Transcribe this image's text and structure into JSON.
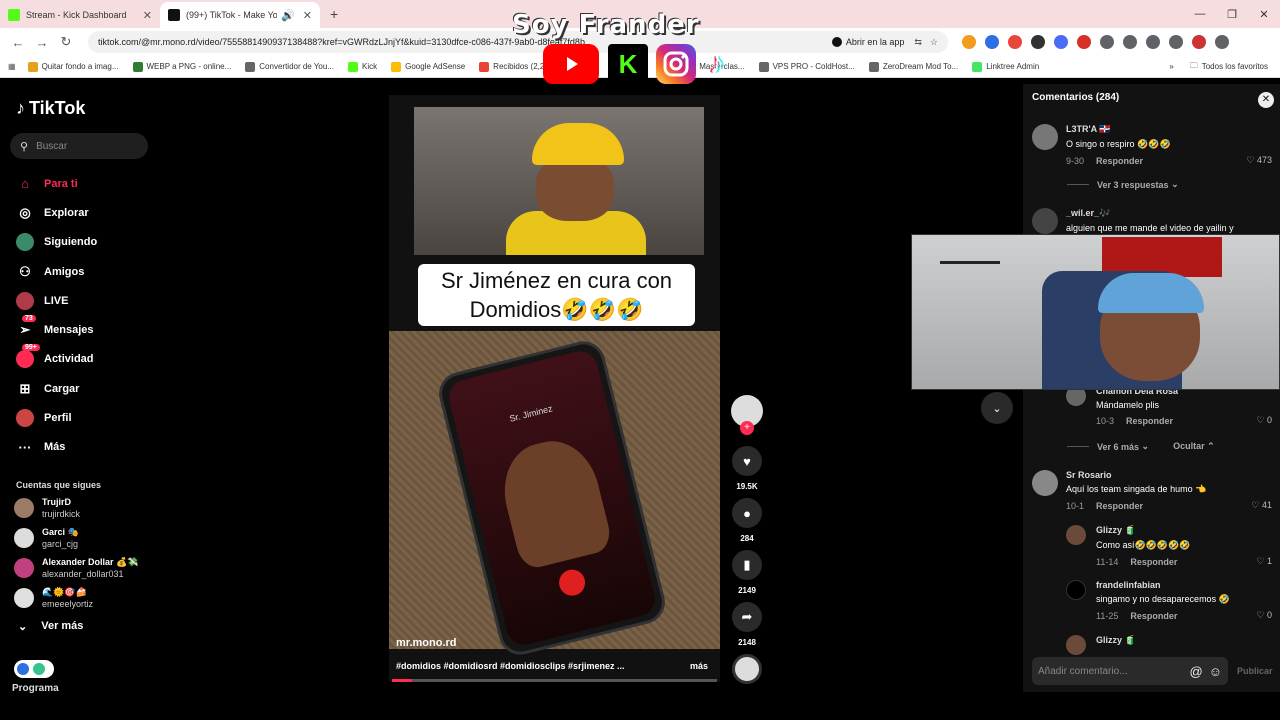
{
  "browser": {
    "tabs": [
      {
        "title": "Stream - Kick Dashboard",
        "color": "#53fc18",
        "active": false
      },
      {
        "title": "(99+) TikTok - Make Your Day",
        "color": "#111111",
        "active": true
      }
    ],
    "url": "tiktok.com/@mr.mono.rd/video/7555881490937138488?kref=vGWRdzLJnjYf&kuid=3130dfce-c086-437f-9ab0-d8feaf7fd8b",
    "open_app": "Abrir en la app",
    "bookmarks": [
      "Quitar fondo a imag...",
      "WEBP a PNG - online...",
      "Convertidor de You...",
      "Kick",
      "Google AdSense",
      "Recibidos (2,229",
      "Masterclas...",
      "VPS PRO - ColdHost...",
      "ZeroDream Mod To...",
      "Linktree Admin"
    ],
    "all_favorites": "Todos los favoritos"
  },
  "overlay": {
    "title": "Soy Frander"
  },
  "sidebar": {
    "brand": "TikTok",
    "search_placeholder": "Buscar",
    "menu": [
      {
        "label": "Para ti",
        "icon": "home-icon",
        "active": true
      },
      {
        "label": "Explorar",
        "icon": "compass-icon",
        "active": false
      },
      {
        "label": "Siguiendo",
        "icon": "following-avatar",
        "active": false
      },
      {
        "label": "Amigos",
        "icon": "friends-icon",
        "active": false
      },
      {
        "label": "LIVE",
        "icon": "live-avatar",
        "active": false
      },
      {
        "label": "Mensajes",
        "icon": "messages-icon",
        "badge": "73",
        "active": false
      },
      {
        "label": "Actividad",
        "icon": "activity-icon",
        "badge": "99+",
        "active": false
      },
      {
        "label": "Cargar",
        "icon": "upload-icon",
        "active": false
      },
      {
        "label": "Perfil",
        "icon": "profile-avatar",
        "active": false
      },
      {
        "label": "Más",
        "icon": "more-icon",
        "active": false
      }
    ],
    "following_header": "Cuentas que sigues",
    "following": [
      {
        "name": "TrujirD",
        "user": "trujirdkick",
        "color": "#9a7b68"
      },
      {
        "name": "Garci 🎭",
        "user": "garci_cjg",
        "color": "#dddddd"
      },
      {
        "name": "Alexander Dollar 💰💸",
        "user": "alexander_dollar031",
        "color": "#c04080"
      },
      {
        "name": "🌊🌞🎯🍰",
        "user": "emeeelyortiz",
        "color": "#e0e0e0"
      }
    ],
    "see_more": "Ver más",
    "programa": "Programa"
  },
  "video": {
    "caption_line1": "Sr Jiménez en cura con",
    "caption_line2": "Domidios🤣🤣🤣",
    "phone_name": "Sr. Jiminez",
    "author": "mr.mono.rd",
    "tags": "#domidios #domidiosrd #domidiosclips #srjimenez ...",
    "more": "más",
    "progress": 0.06,
    "likes": "19.5K",
    "comments": "284",
    "saves": "2149",
    "shares": "2148"
  },
  "comments": {
    "header": "Comentarios (284)",
    "input_placeholder": "Añadir comentario...",
    "post": "Publicar",
    "reply_label": "Responder",
    "items": [
      {
        "name": "L3TR'A 🇩🇴",
        "text": "O singo o respiro 🤣🤣🤣",
        "date": "9-30",
        "likes": "473"
      },
      {
        "name": "_wil.er_🎶",
        "text": "alguien que me mande el video de yailin y"
      },
      {
        "name": "Chamon Dela Rosa",
        "text": "Mándamelo plis",
        "date": "10-3",
        "likes": "0"
      },
      {
        "name": "Sr Rosario",
        "text": "Aquí los team singada de humo 👈",
        "date": "10-1",
        "likes": "41"
      },
      {
        "name": "Glizzy 🧃",
        "text": "Como así🤣🤣🤣🤣🤣",
        "date": "11-14",
        "likes": "1"
      },
      {
        "name": "frandelinfabian",
        "text": "singamo y no desaparecemos 🤣",
        "date": "11-25",
        "likes": "0"
      },
      {
        "name": "Glizzy 🧃"
      }
    ],
    "view_replies_1": "Ver 3 respuestas",
    "view_more_2": "Ver 6 más",
    "hide": "Ocultar"
  }
}
